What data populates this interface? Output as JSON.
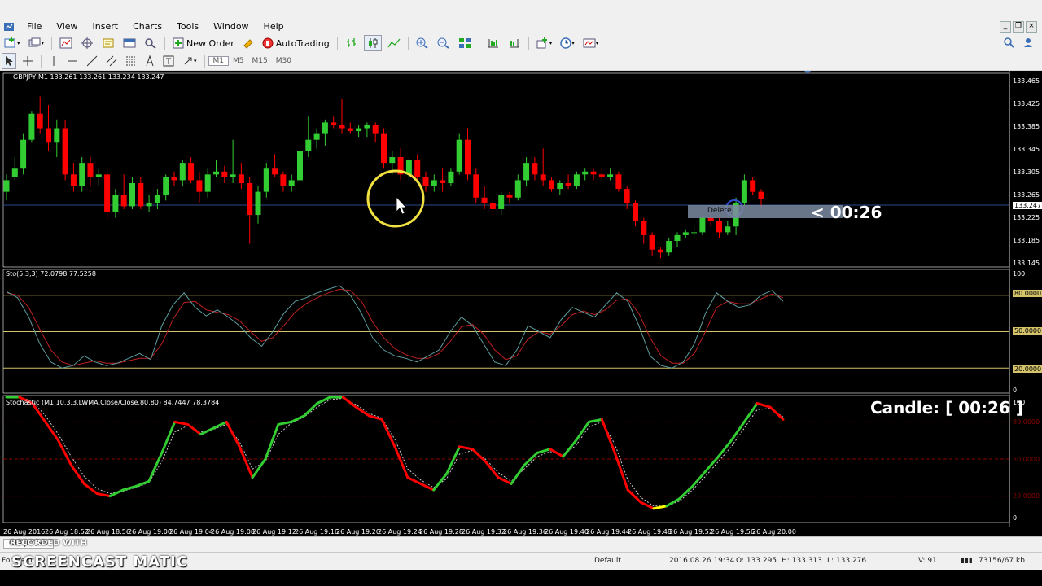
{
  "menu": [
    "File",
    "View",
    "Insert",
    "Charts",
    "Tools",
    "Window",
    "Help"
  ],
  "toolbar": {
    "new_order": "New Order",
    "autotrading": "AutoTrading",
    "timeframes": [
      "M1",
      "M5",
      "M15",
      "M30"
    ]
  },
  "chart": {
    "symbol_header": "GBPJPY,M1  133.261 133.261 133.234 133.247",
    "price_ticks": [
      "133.465",
      "133.425",
      "133.385",
      "133.345",
      "133.305",
      "133.265",
      "133.225",
      "133.185",
      "133.145"
    ],
    "current_price": "133.247",
    "countdown": "<  00:26",
    "delete_popup": "Delete",
    "bull_color": "#32cd32",
    "bear_color": "#ff0000",
    "background": "#000000"
  },
  "sto_pane": {
    "label": "Sto(5,3,3) 72.0798 77.5258",
    "levels": [
      "80.0000",
      "50.0000",
      "20.0000"
    ],
    "top": "100",
    "bottom": "0"
  },
  "stochastic_pane": {
    "label": "Stochastic (M1,10,3,3,LWMA,Close/Close,80,80) 84.7447 78.3784",
    "levels": [
      "80.0000",
      "50.0000",
      "20.0000"
    ],
    "top": "100",
    "bottom": "0",
    "candle_timer": "Candle: [ 00:26 ]"
  },
  "time_axis": [
    "26 Aug 2016",
    "26 Aug 18:52",
    "26 Aug 18:56",
    "26 Aug 19:00",
    "26 Aug 19:04",
    "26 Aug 19:08",
    "26 Aug 19:12",
    "26 Aug 19:16",
    "26 Aug 19:20",
    "26 Aug 19:24",
    "26 Aug 19:28",
    "26 Aug 19:32",
    "26 Aug 19:36",
    "26 Aug 19:40",
    "26 Aug 19:44",
    "26 Aug 19:48",
    "26 Aug 19:52",
    "26 Aug 19:56",
    "26 Aug 20:00"
  ],
  "tab": "GBPJPY,M5",
  "status": {
    "help": "For Help",
    "profile": "Default",
    "datetime": "2016.08.26 19:34",
    "open": "O: 133.295",
    "high": "H: 133.313",
    "low": "L: 133.276",
    "volume": "V: 91",
    "traffic": "73156/67 kb"
  },
  "watermark": {
    "recorded": "RECORDED WITH",
    "brand": "SCREENCAST  MATIC"
  },
  "candles": [
    {
      "o": 133.27,
      "h": 133.3,
      "l": 133.255,
      "c": 133.29
    },
    {
      "o": 133.295,
      "h": 133.33,
      "l": 133.29,
      "c": 133.31
    },
    {
      "o": 133.31,
      "h": 133.37,
      "l": 133.3,
      "c": 133.36
    },
    {
      "o": 133.36,
      "h": 133.41,
      "l": 133.355,
      "c": 133.405
    },
    {
      "o": 133.405,
      "h": 133.435,
      "l": 133.37,
      "c": 133.38
    },
    {
      "o": 133.38,
      "h": 133.42,
      "l": 133.34,
      "c": 133.355
    },
    {
      "o": 133.355,
      "h": 133.395,
      "l": 133.33,
      "c": 133.38
    },
    {
      "o": 133.38,
      "h": 133.395,
      "l": 133.29,
      "c": 133.3
    },
    {
      "o": 133.3,
      "h": 133.32,
      "l": 133.27,
      "c": 133.28
    },
    {
      "o": 133.28,
      "h": 133.33,
      "l": 133.27,
      "c": 133.32
    },
    {
      "o": 133.32,
      "h": 133.33,
      "l": 133.28,
      "c": 133.295
    },
    {
      "o": 133.295,
      "h": 133.31,
      "l": 133.28,
      "c": 133.3
    },
    {
      "o": 133.3,
      "h": 133.31,
      "l": 133.22,
      "c": 133.235
    },
    {
      "o": 133.235,
      "h": 133.275,
      "l": 133.225,
      "c": 133.265
    },
    {
      "o": 133.265,
      "h": 133.3,
      "l": 133.24,
      "c": 133.245
    },
    {
      "o": 133.245,
      "h": 133.295,
      "l": 133.24,
      "c": 133.285
    },
    {
      "o": 133.285,
      "h": 133.295,
      "l": 133.24,
      "c": 133.245
    },
    {
      "o": 133.245,
      "h": 133.265,
      "l": 133.235,
      "c": 133.25
    },
    {
      "o": 133.25,
      "h": 133.275,
      "l": 133.24,
      "c": 133.265
    },
    {
      "o": 133.265,
      "h": 133.3,
      "l": 133.255,
      "c": 133.295
    },
    {
      "o": 133.295,
      "h": 133.305,
      "l": 133.28,
      "c": 133.29
    },
    {
      "o": 133.29,
      "h": 133.325,
      "l": 133.28,
      "c": 133.32
    },
    {
      "o": 133.32,
      "h": 133.33,
      "l": 133.285,
      "c": 133.29
    },
    {
      "o": 133.29,
      "h": 133.305,
      "l": 133.25,
      "c": 133.27
    },
    {
      "o": 133.27,
      "h": 133.31,
      "l": 133.26,
      "c": 133.3
    },
    {
      "o": 133.3,
      "h": 133.325,
      "l": 133.295,
      "c": 133.305
    },
    {
      "o": 133.305,
      "h": 133.315,
      "l": 133.285,
      "c": 133.295
    },
    {
      "o": 133.295,
      "h": 133.36,
      "l": 133.285,
      "c": 133.3
    },
    {
      "o": 133.3,
      "h": 133.32,
      "l": 133.275,
      "c": 133.285
    },
    {
      "o": 133.285,
      "h": 133.295,
      "l": 133.18,
      "c": 133.23
    },
    {
      "o": 133.23,
      "h": 133.28,
      "l": 133.215,
      "c": 133.27
    },
    {
      "o": 133.27,
      "h": 133.32,
      "l": 133.26,
      "c": 133.31
    },
    {
      "o": 133.31,
      "h": 133.335,
      "l": 133.295,
      "c": 133.3
    },
    {
      "o": 133.3,
      "h": 133.305,
      "l": 133.27,
      "c": 133.28
    },
    {
      "o": 133.28,
      "h": 133.3,
      "l": 133.27,
      "c": 133.29
    },
    {
      "o": 133.29,
      "h": 133.345,
      "l": 133.285,
      "c": 133.34
    },
    {
      "o": 133.34,
      "h": 133.4,
      "l": 133.33,
      "c": 133.36
    },
    {
      "o": 133.36,
      "h": 133.38,
      "l": 133.345,
      "c": 133.37
    },
    {
      "o": 133.37,
      "h": 133.395,
      "l": 133.35,
      "c": 133.39
    },
    {
      "o": 133.39,
      "h": 133.4,
      "l": 133.38,
      "c": 133.385
    },
    {
      "o": 133.385,
      "h": 133.43,
      "l": 133.37,
      "c": 133.38
    },
    {
      "o": 133.38,
      "h": 133.39,
      "l": 133.37,
      "c": 133.375
    },
    {
      "o": 133.375,
      "h": 133.385,
      "l": 133.365,
      "c": 133.38
    },
    {
      "o": 133.38,
      "h": 133.39,
      "l": 133.365,
      "c": 133.385
    },
    {
      "o": 133.385,
      "h": 133.39,
      "l": 133.355,
      "c": 133.37
    },
    {
      "o": 133.37,
      "h": 133.38,
      "l": 133.31,
      "c": 133.32
    },
    {
      "o": 133.32,
      "h": 133.34,
      "l": 133.3,
      "c": 133.33
    },
    {
      "o": 133.33,
      "h": 133.345,
      "l": 133.29,
      "c": 133.3
    },
    {
      "o": 133.3,
      "h": 133.33,
      "l": 133.29,
      "c": 133.325
    },
    {
      "o": 133.325,
      "h": 133.335,
      "l": 133.29,
      "c": 133.295
    },
    {
      "o": 133.295,
      "h": 133.305,
      "l": 133.27,
      "c": 133.28
    },
    {
      "o": 133.28,
      "h": 133.3,
      "l": 133.27,
      "c": 133.29
    },
    {
      "o": 133.29,
      "h": 133.31,
      "l": 133.27,
      "c": 133.285
    },
    {
      "o": 133.285,
      "h": 133.31,
      "l": 133.28,
      "c": 133.305
    },
    {
      "o": 133.305,
      "h": 133.37,
      "l": 133.3,
      "c": 133.36
    },
    {
      "o": 133.36,
      "h": 133.38,
      "l": 133.29,
      "c": 133.3
    },
    {
      "o": 133.3,
      "h": 133.31,
      "l": 133.25,
      "c": 133.26
    },
    {
      "o": 133.26,
      "h": 133.28,
      "l": 133.24,
      "c": 133.25
    },
    {
      "o": 133.25,
      "h": 133.26,
      "l": 133.23,
      "c": 133.24
    },
    {
      "o": 133.24,
      "h": 133.27,
      "l": 133.23,
      "c": 133.265
    },
    {
      "o": 133.265,
      "h": 133.27,
      "l": 133.25,
      "c": 133.26
    },
    {
      "o": 133.26,
      "h": 133.3,
      "l": 133.255,
      "c": 133.29
    },
    {
      "o": 133.29,
      "h": 133.33,
      "l": 133.28,
      "c": 133.32
    },
    {
      "o": 133.32,
      "h": 133.33,
      "l": 133.29,
      "c": 133.3
    },
    {
      "o": 133.3,
      "h": 133.345,
      "l": 133.28,
      "c": 133.29
    },
    {
      "o": 133.29,
      "h": 133.295,
      "l": 133.27,
      "c": 133.275
    },
    {
      "o": 133.275,
      "h": 133.29,
      "l": 133.265,
      "c": 133.285
    },
    {
      "o": 133.285,
      "h": 133.3,
      "l": 133.275,
      "c": 133.28
    },
    {
      "o": 133.28,
      "h": 133.305,
      "l": 133.275,
      "c": 133.3
    },
    {
      "o": 133.3,
      "h": 133.31,
      "l": 133.29,
      "c": 133.305
    },
    {
      "o": 133.305,
      "h": 133.31,
      "l": 133.29,
      "c": 133.3
    },
    {
      "o": 133.3,
      "h": 133.31,
      "l": 133.29,
      "c": 133.295
    },
    {
      "o": 133.295,
      "h": 133.31,
      "l": 133.29,
      "c": 133.3
    },
    {
      "o": 133.3,
      "h": 133.305,
      "l": 133.27,
      "c": 133.275
    },
    {
      "o": 133.275,
      "h": 133.28,
      "l": 133.24,
      "c": 133.25
    },
    {
      "o": 133.25,
      "h": 133.255,
      "l": 133.21,
      "c": 133.22
    },
    {
      "o": 133.22,
      "h": 133.225,
      "l": 133.18,
      "c": 133.195
    },
    {
      "o": 133.195,
      "h": 133.2,
      "l": 133.16,
      "c": 133.17
    },
    {
      "o": 133.17,
      "h": 133.175,
      "l": 133.155,
      "c": 133.165
    },
    {
      "o": 133.165,
      "h": 133.19,
      "l": 133.16,
      "c": 133.185
    },
    {
      "o": 133.185,
      "h": 133.2,
      "l": 133.175,
      "c": 133.195
    },
    {
      "o": 133.195,
      "h": 133.205,
      "l": 133.19,
      "c": 133.2
    },
    {
      "o": 133.2,
      "h": 133.21,
      "l": 133.19,
      "c": 133.2
    },
    {
      "o": 133.2,
      "h": 133.23,
      "l": 133.195,
      "c": 133.225
    },
    {
      "o": 133.225,
      "h": 133.24,
      "l": 133.21,
      "c": 133.22
    },
    {
      "o": 133.22,
      "h": 133.225,
      "l": 133.19,
      "c": 133.2
    },
    {
      "o": 133.2,
      "h": 133.22,
      "l": 133.195,
      "c": 133.21
    },
    {
      "o": 133.21,
      "h": 133.26,
      "l": 133.195,
      "c": 133.25
    },
    {
      "o": 133.25,
      "h": 133.3,
      "l": 133.245,
      "c": 133.29
    },
    {
      "o": 133.29,
      "h": 133.295,
      "l": 133.265,
      "c": 133.27
    },
    {
      "o": 133.27,
      "h": 133.275,
      "l": 133.24,
      "c": 133.257
    }
  ],
  "sto_main": [
    83,
    78,
    62,
    40,
    25,
    20,
    22,
    30,
    25,
    22,
    24,
    28,
    32,
    27,
    55,
    72,
    82,
    70,
    63,
    68,
    62,
    55,
    45,
    38,
    50,
    65,
    75,
    78,
    82,
    85,
    88,
    80,
    65,
    45,
    35,
    30,
    28,
    25,
    30,
    35,
    50,
    62,
    55,
    40,
    25,
    22,
    35,
    55,
    50,
    45,
    60,
    70,
    66,
    62,
    72,
    82,
    75,
    55,
    30,
    22,
    20,
    25,
    40,
    65,
    82,
    75,
    70,
    72,
    80,
    84,
    75
  ],
  "sto_signal": [
    82,
    80,
    70,
    52,
    35,
    25,
    22,
    24,
    26,
    24,
    24,
    26,
    28,
    28,
    40,
    60,
    74,
    75,
    68,
    66,
    64,
    59,
    50,
    42,
    45,
    55,
    66,
    73,
    78,
    82,
    85,
    84,
    75,
    58,
    45,
    36,
    31,
    28,
    28,
    32,
    42,
    54,
    56,
    48,
    35,
    27,
    30,
    44,
    50,
    48,
    55,
    64,
    67,
    64,
    68,
    76,
    77,
    65,
    45,
    30,
    24,
    24,
    32,
    50,
    70,
    75,
    73,
    73,
    77,
    81,
    78
  ],
  "stoch2_main": [
    100,
    100,
    95,
    80,
    65,
    45,
    30,
    22,
    20,
    25,
    28,
    32,
    55,
    80,
    78,
    70,
    75,
    80,
    60,
    35,
    50,
    78,
    80,
    85,
    95,
    100,
    100,
    92,
    85,
    82,
    60,
    35,
    30,
    25,
    38,
    60,
    58,
    48,
    35,
    30,
    45,
    55,
    58,
    52,
    65,
    80,
    82,
    55,
    25,
    15,
    10,
    12,
    18,
    28,
    40,
    52,
    65,
    80,
    95,
    92,
    82
  ],
  "stoch2_signal": [
    100,
    100,
    97,
    85,
    70,
    52,
    36,
    26,
    22,
    24,
    27,
    31,
    48,
    72,
    77,
    72,
    74,
    78,
    64,
    42,
    48,
    70,
    79,
    84,
    92,
    98,
    99,
    94,
    87,
    83,
    66,
    42,
    33,
    27,
    34,
    54,
    57,
    50,
    39,
    32,
    42,
    52,
    56,
    53,
    61,
    76,
    80,
    62,
    33,
    19,
    12,
    12,
    16,
    25,
    36,
    48,
    60,
    75,
    90,
    91,
    84
  ]
}
